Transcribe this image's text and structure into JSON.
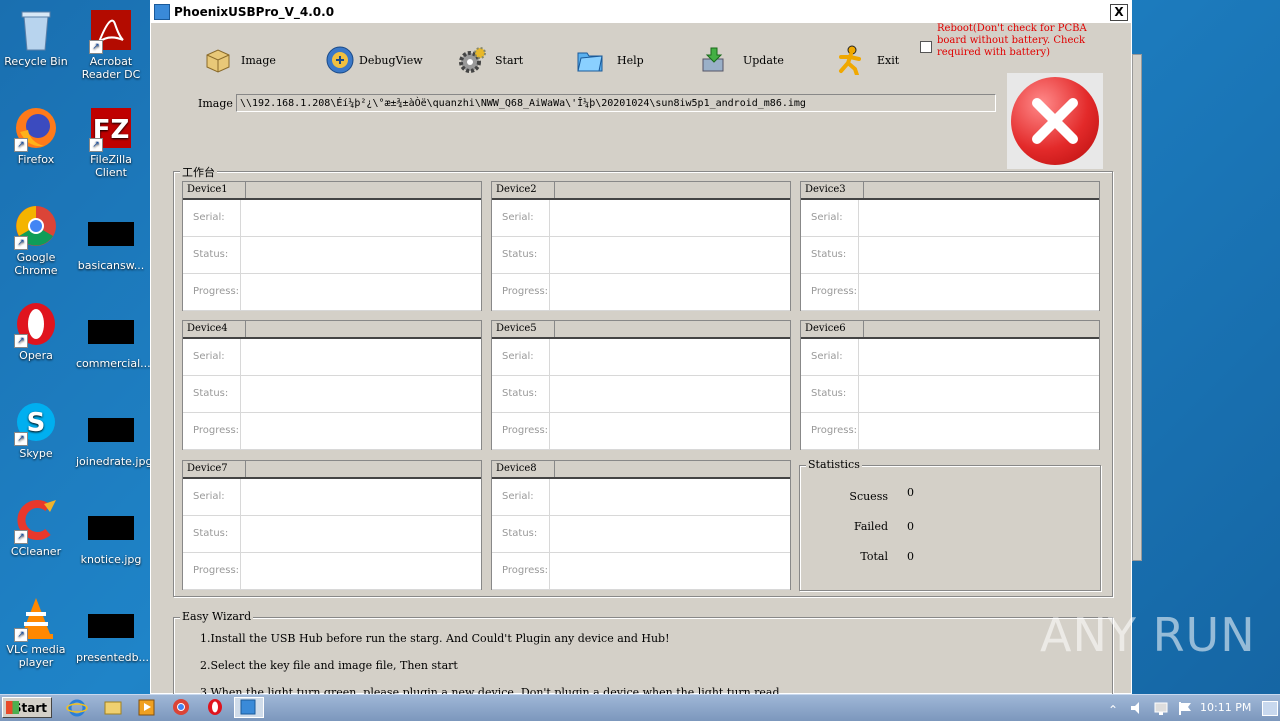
{
  "desktop": {
    "col1": [
      {
        "label": "Recycle Bin",
        "icon": "recycle-bin-icon"
      },
      {
        "label": "Firefox",
        "icon": "firefox-icon"
      },
      {
        "label": "Google Chrome",
        "icon": "chrome-icon"
      },
      {
        "label": "Opera",
        "icon": "opera-icon"
      },
      {
        "label": "Skype",
        "icon": "skype-icon"
      },
      {
        "label": "CCleaner",
        "icon": "ccleaner-icon"
      },
      {
        "label": "VLC media player",
        "icon": "vlc-icon"
      }
    ],
    "col2": [
      {
        "label": "Acrobat Reader DC",
        "icon": "acrobat-icon"
      },
      {
        "label": "FileZilla Client",
        "icon": "filezilla-icon"
      },
      {
        "label": "basicansw...",
        "icon": "file-icon"
      },
      {
        "label": "commercial...",
        "icon": "file-icon"
      },
      {
        "label": "joinedrate.jpg",
        "icon": "file-icon"
      },
      {
        "label": "knotice.jpg",
        "icon": "file-icon"
      },
      {
        "label": "presentedb...",
        "icon": "file-icon"
      }
    ]
  },
  "window": {
    "title": "PhoenixUSBPro_V_4.0.0",
    "close": "X",
    "toolbar": [
      {
        "label": "Image",
        "icon": "image-box-icon"
      },
      {
        "label": "DebugView",
        "icon": "debugview-icon"
      },
      {
        "label": "Start",
        "icon": "gear-icon"
      },
      {
        "label": "Help",
        "icon": "folder-help-icon"
      },
      {
        "label": "Update",
        "icon": "update-icon"
      },
      {
        "label": "Exit",
        "icon": "exit-runner-icon"
      }
    ],
    "reboot_text": "Reboot(Don't check for PCBA board without battery. Check required with battery)",
    "image_label": "Image",
    "image_path": "\\\\192.168.1.208\\Éí¼þ²¿\\°æ±¾±àÒë\\quanzhi\\NWW_Q68_AiWaWa\\'Î¼þ\\20201024\\sun8iw5p1_android_m86.img",
    "workbench_label": "工作台",
    "devices": [
      {
        "name": "Device1"
      },
      {
        "name": "Device2"
      },
      {
        "name": "Device3"
      },
      {
        "name": "Device4"
      },
      {
        "name": "Device5"
      },
      {
        "name": "Device6"
      },
      {
        "name": "Device7"
      },
      {
        "name": "Device8"
      }
    ],
    "device_fields": {
      "serial": "Serial:",
      "status": "Status:",
      "progress": "Progress:"
    },
    "statistics": {
      "label": "Statistics",
      "success_label": "Scuess",
      "success_value": "0",
      "failed_label": "Failed",
      "failed_value": "0",
      "total_label": "Total",
      "total_value": "0"
    },
    "wizard": {
      "label": "Easy Wizard",
      "step1": "1.Install the USB Hub before run the starg. And Could't Plugin any device and Hub!",
      "step2": "2.Select the key file and image file, Then start",
      "step3": "3.When the light turn green, please plugin a new device. Don't plugin a device when the light turn read"
    }
  },
  "taskbar": {
    "start": "Start",
    "clock": "10:11 PM"
  },
  "watermark": "ANY RUN",
  "colors": {
    "reboot_text": "#e00000",
    "desktop": "#1f84c8",
    "window_bg": "#d4d0c8"
  }
}
